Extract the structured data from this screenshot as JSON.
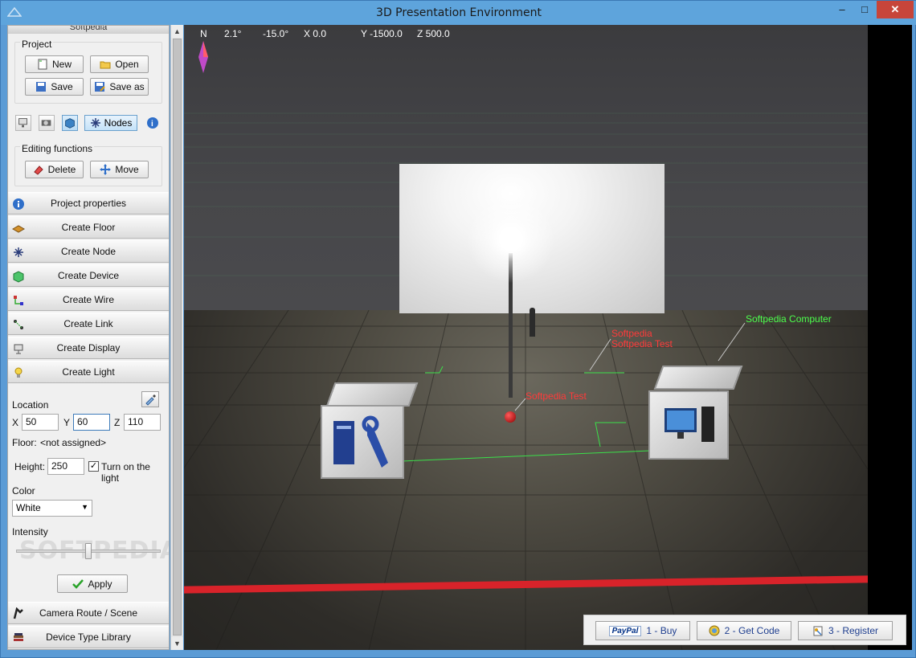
{
  "window": {
    "title": "3D Presentation Environment",
    "minimize": "–",
    "maximize": "□",
    "close": "✕"
  },
  "panel": {
    "header": "Softpedia",
    "project_group": "Project",
    "new": "New",
    "open": "Open",
    "save": "Save",
    "save_as": "Save as",
    "nodes": "Nodes",
    "editing_group": "Editing functions",
    "delete": "Delete",
    "move": "Move",
    "sections": [
      "Project properties",
      "Create Floor",
      "Create Node",
      "Create Device",
      "Create Wire",
      "Create Link",
      "Create Display",
      "Create Light"
    ],
    "location_label": "Location",
    "x_label": "X",
    "x_value": "50",
    "y_label": "Y",
    "y_value": "60",
    "z_label": "Z",
    "z_value": "110",
    "floor_label": "Floor:",
    "floor_value": "<not assigned>",
    "height_label": "Height:",
    "height_value": "250",
    "turn_on_light": "Turn on the light",
    "turn_on_checked": "✓",
    "color_label": "Color",
    "color_value": "White",
    "intensity_label": "Intensity",
    "intensity_fraction": 0.5,
    "watermark": "SOFTPEDIA",
    "apply": "Apply",
    "bottom_sections": [
      "Camera Route / Scene",
      "Device Type Library"
    ]
  },
  "viewport": {
    "hud": {
      "n": "N",
      "angle1": "2.1°",
      "angle2": "-15.0°",
      "x": "X 0.0",
      "y": "Y -1500.0",
      "z": "Z 500.0"
    },
    "labels": {
      "softpedia": "Softpedia",
      "softpedia_test": "Softpedia Test",
      "softpedia_test2": "Softpedia Test",
      "softpedia_computer": "Softpedia Computer"
    }
  },
  "bottombar": {
    "buy": "1 - Buy",
    "paypal": "PayPal",
    "get_code": "2 - Get Code",
    "register": "3 - Register"
  },
  "colors": {
    "titlebar": "#5ea4dc",
    "accent_red": "#d8232a",
    "label_red": "#ff3a3a",
    "label_green": "#4cff4c"
  }
}
